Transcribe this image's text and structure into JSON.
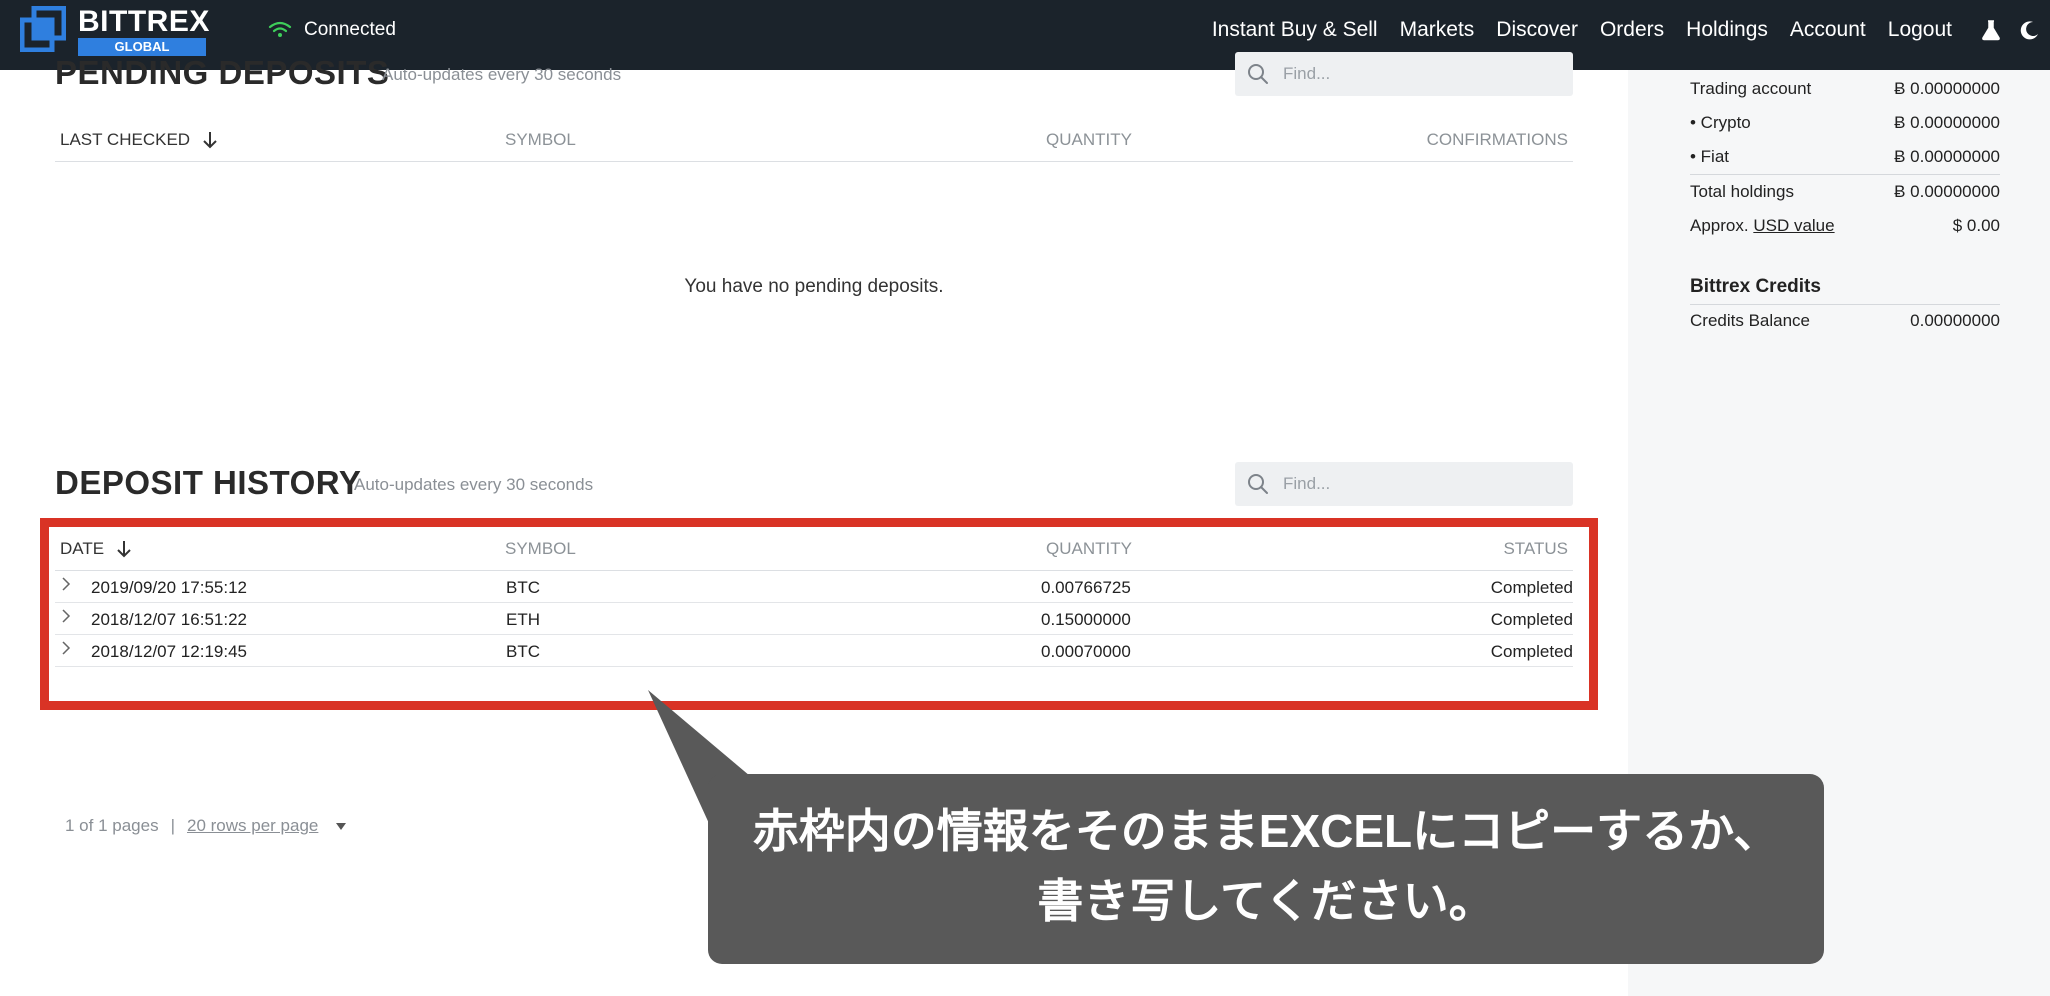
{
  "navbar": {
    "brand": "BITTREX",
    "brand_sub": "GLOBAL",
    "connection_status": "Connected",
    "items": [
      "Instant Buy & Sell",
      "Markets",
      "Discover",
      "Orders",
      "Holdings",
      "Account",
      "Logout"
    ],
    "icons": [
      "flask-icon",
      "moon-icon"
    ]
  },
  "pending_deposits": {
    "title": "PENDING DEPOSITS",
    "subtitle": "Auto-updates every 30 seconds",
    "search_placeholder": "Find...",
    "columns": [
      "LAST CHECKED",
      "SYMBOL",
      "QUANTITY",
      "CONFIRMATIONS"
    ],
    "empty_message": "You have no pending deposits."
  },
  "deposit_history": {
    "title": "DEPOSIT HISTORY",
    "subtitle": "Auto-updates every 30 seconds",
    "search_placeholder": "Find...",
    "columns": [
      "DATE",
      "SYMBOL",
      "QUANTITY",
      "STATUS"
    ],
    "rows": [
      {
        "date": "2019/09/20 17:55:12",
        "symbol": "BTC",
        "quantity": "0.00766725",
        "status": "Completed"
      },
      {
        "date": "2018/12/07 16:51:22",
        "symbol": "ETH",
        "quantity": "0.15000000",
        "status": "Completed"
      },
      {
        "date": "2018/12/07 12:19:45",
        "symbol": "BTC",
        "quantity": "0.00070000",
        "status": "Completed"
      }
    ],
    "pagination": {
      "pages": "1 of 1 pages",
      "separator": "|",
      "rows_per_page": "20 rows per page"
    }
  },
  "balances": {
    "rows": [
      {
        "label": "Trading account",
        "value": "Ƀ 0.00000000"
      },
      {
        "label": "• Crypto",
        "value": "Ƀ 0.00000000"
      },
      {
        "label": "• Fiat",
        "value": "Ƀ 0.00000000"
      },
      {
        "label": "Total holdings",
        "value": "Ƀ 0.00000000"
      }
    ],
    "usd_prefix": "Approx.",
    "usd_link": "USD value",
    "usd_value": "$ 0.00"
  },
  "credits": {
    "title": "Bittrex Credits",
    "label": "Credits Balance",
    "value": "0.00000000"
  },
  "callout": {
    "line1": "赤枠内の情報をそのままEXCELにコピーするか、",
    "line2": "書き写してください。"
  },
  "colors": {
    "navbar_bg": "#1b232b",
    "brand_blue": "#2f7fdf",
    "connected_green": "#3ecf5a",
    "highlight_red": "#d93325",
    "callout_bg": "#595959",
    "panel_bg": "#f6f7f8"
  }
}
